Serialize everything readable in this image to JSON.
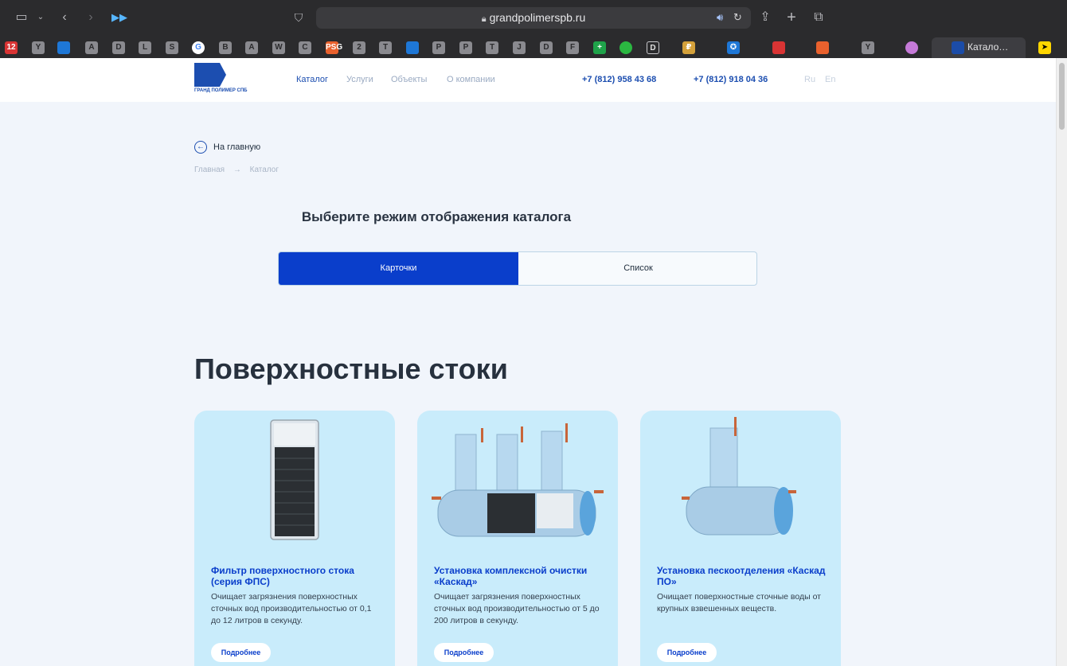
{
  "browser": {
    "url": "grandpolimerspb.ru",
    "active_tab": "Катало…",
    "bookmarks": [
      "12",
      "Y",
      "",
      "A",
      "D",
      "L",
      "S",
      "G",
      "B",
      "A",
      "W",
      "C",
      "PSG",
      "2",
      "T",
      "",
      "P",
      "P",
      "T",
      "J",
      "D",
      "F",
      "+",
      "",
      "D",
      "₽",
      "✪",
      "",
      "",
      "Y",
      "",
      ""
    ]
  },
  "header": {
    "logo_text": "ГРАНД ПОЛИМЕР СПБ",
    "nav": [
      "Каталог",
      "Услуги",
      "Объекты",
      "О компании"
    ],
    "phones": [
      "+7 (812) 958 43 68",
      "+7 (812) 918 04 36"
    ],
    "langs": [
      "Ru",
      "En"
    ]
  },
  "page": {
    "back_label": "На главную",
    "breadcrumbs": [
      "Главная",
      "→",
      "Каталог"
    ],
    "mode_title": "Выберите режим отображения каталога",
    "mode_cards": "Карточки",
    "mode_list": "Список",
    "section_title": "Поверхностные стоки"
  },
  "cards": [
    {
      "title": "Фильтр поверхностного стока (серия ФПС)",
      "desc": "Очищает загрязнения поверхностных сточных вод производительностью от 0,1 до 12 литров в секунду.",
      "button": "Подробнее"
    },
    {
      "title": "Установка комплексной очистки «Каскад»",
      "desc": "Очищает загрязнения поверхностных сточных вод производительностью от 5 до 200 литров в секунду.",
      "button": "Подробнее"
    },
    {
      "title": "Установка пескоотделения «Каскад ПО»",
      "desc": "Очищает поверхностные сточные воды от крупных взвешенных веществ.",
      "button": "Подробнее"
    }
  ],
  "colors": {
    "brand": "#0a3ecb",
    "card_bg": "#c9ecfb",
    "page_bg": "#f1f5fb"
  }
}
